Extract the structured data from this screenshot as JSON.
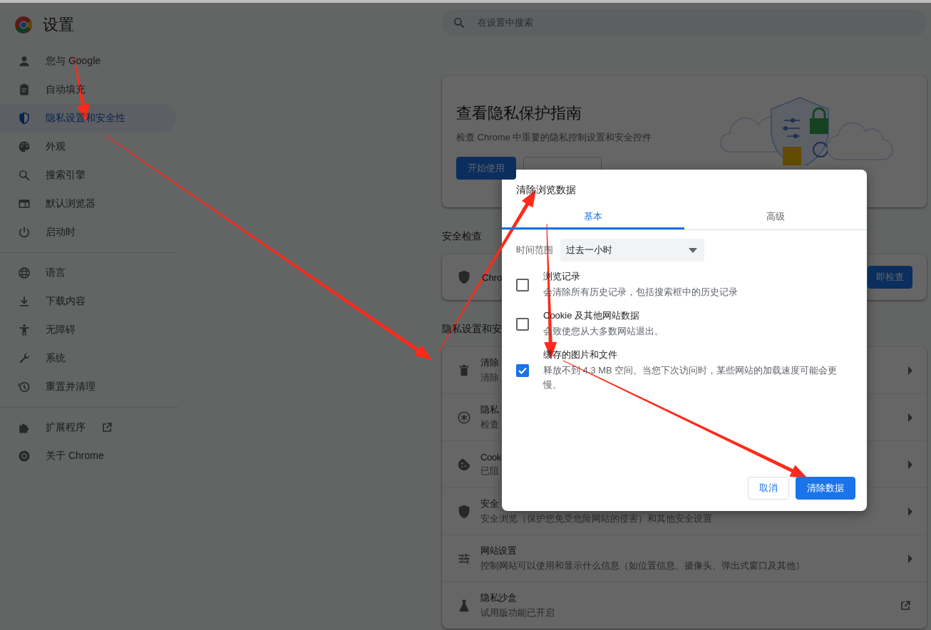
{
  "header": {
    "title": "设置"
  },
  "search": {
    "placeholder": "在设置中搜索"
  },
  "sidebar": {
    "groups": [
      [
        {
          "label": "您与 Google",
          "selected": false
        },
        {
          "label": "自动填充",
          "selected": false
        },
        {
          "label": "隐私设置和安全性",
          "selected": true
        },
        {
          "label": "外观",
          "selected": false
        },
        {
          "label": "搜索引擎",
          "selected": false
        },
        {
          "label": "默认浏览器",
          "selected": false
        },
        {
          "label": "启动时",
          "selected": false
        }
      ],
      [
        {
          "label": "语言",
          "selected": false
        },
        {
          "label": "下载内容",
          "selected": false
        },
        {
          "label": "无障碍",
          "selected": false
        },
        {
          "label": "系统",
          "selected": false
        },
        {
          "label": "重置并清理",
          "selected": false
        }
      ],
      [
        {
          "label": "扩展程序",
          "selected": false,
          "external": true
        },
        {
          "label": "关于 Chrome",
          "selected": false
        }
      ]
    ]
  },
  "guide_card": {
    "title": "查看隐私保护指南",
    "description": "检查 Chrome 中重要的隐私控制设置和安全控件",
    "buttons": [
      {
        "label": "开始使用",
        "kind": "primary"
      },
      {
        "kind": "outline"
      }
    ]
  },
  "safety_check": {
    "heading": "安全检查",
    "text": "Chro",
    "button": "即检查"
  },
  "privacy_section": {
    "heading": "隐私设置和安",
    "rows": [
      {
        "title": "清除",
        "subtitle": "清除",
        "kind": "arrow"
      },
      {
        "title": "隐私",
        "subtitle": "检查",
        "kind": "arrow"
      },
      {
        "title": "Cook",
        "subtitle": "已阻",
        "kind": "arrow"
      },
      {
        "title": "安全",
        "subtitle": "安全浏览（保护您免受危险网站的侵害）和其他安全设置",
        "kind": "arrow"
      },
      {
        "title": "网站设置",
        "subtitle": "控制网站可以使用和显示什么信息（如位置信息、摄像头、弹出式窗口及其他）",
        "kind": "arrow"
      },
      {
        "title": "隐私沙盒",
        "subtitle": "试用版功能已开启",
        "kind": "external"
      }
    ]
  },
  "dialog": {
    "title": "清除浏览数据",
    "tabs": [
      {
        "label": "基本",
        "selected": true
      },
      {
        "label": "高级",
        "selected": false
      }
    ],
    "time_range": {
      "label": "时间范围",
      "value": "过去一小时"
    },
    "options": [
      {
        "title": "浏览记录",
        "description": "会清除所有历史记录，包括搜索框中的历史记录",
        "checked": false
      },
      {
        "title": "Cookie 及其他网站数据",
        "description": "会致使您从大多数网站退出。",
        "checked": false
      },
      {
        "title": "缓存的图片和文件",
        "description": "释放不到 4.3 MB 空间。当您下次访问时，某些网站的加载速度可能会更慢。",
        "checked": true
      }
    ],
    "buttons": [
      {
        "label": "取消",
        "kind": "secondary"
      },
      {
        "label": "清除数据",
        "kind": "primary"
      }
    ]
  }
}
